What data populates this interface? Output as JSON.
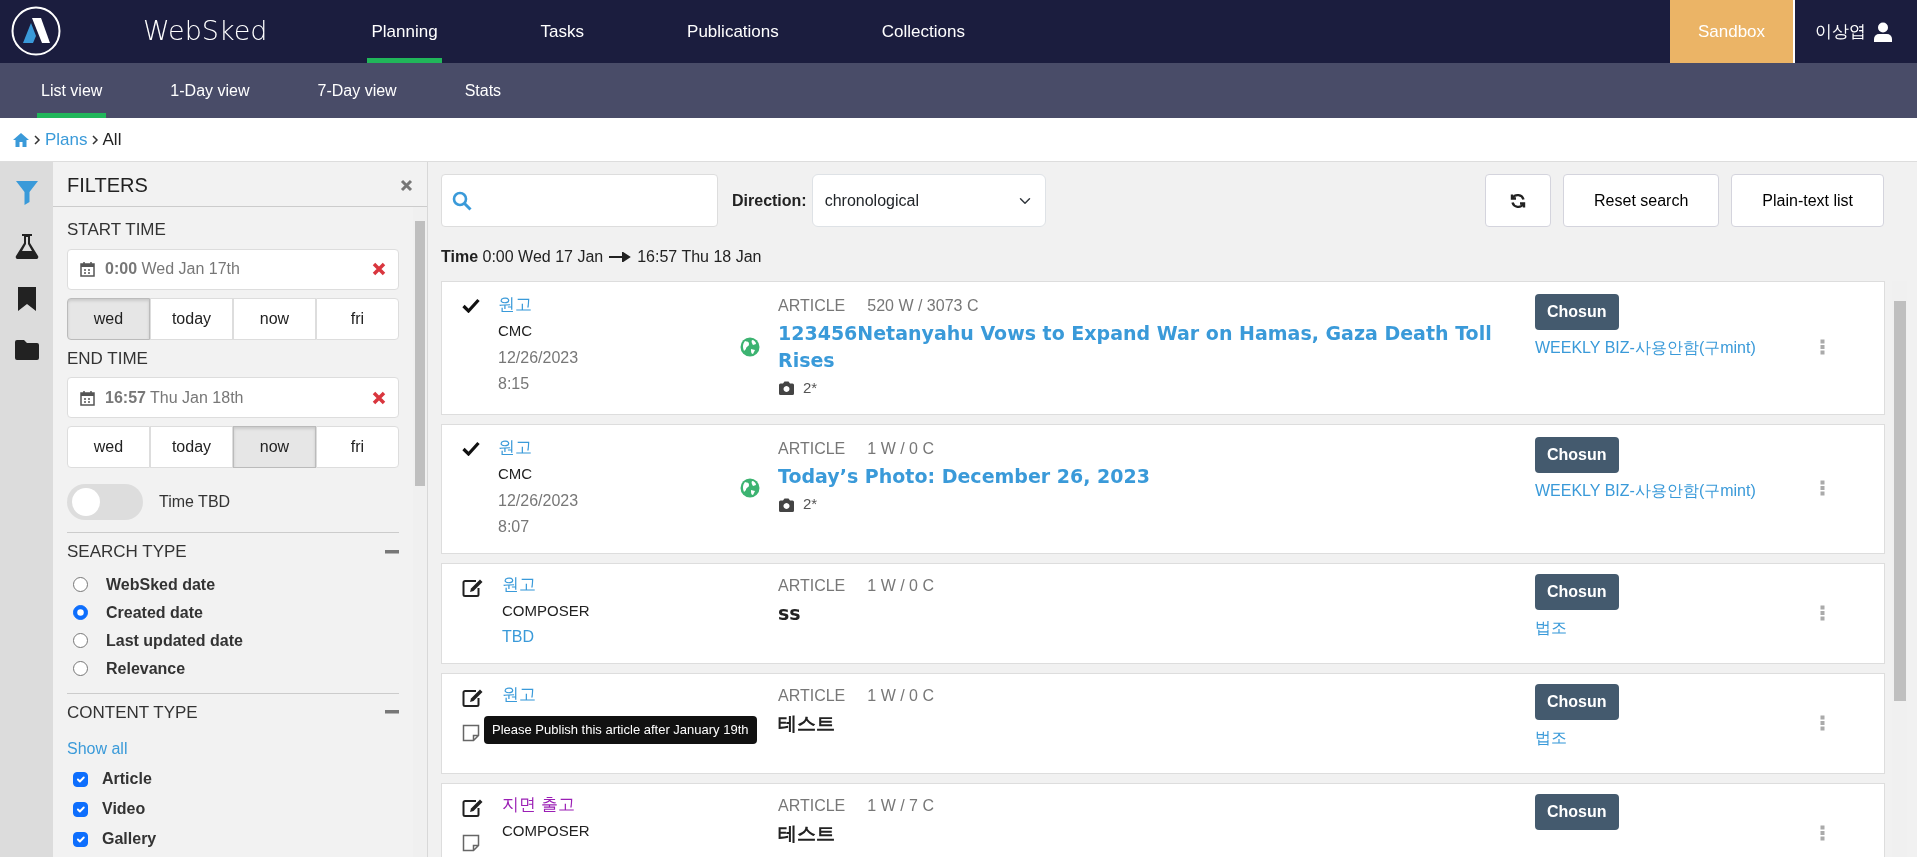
{
  "app": {
    "name": "WebSked"
  },
  "nav_tabs": [
    {
      "label": "Planning",
      "selected": true
    },
    {
      "label": "Tasks",
      "selected": false
    },
    {
      "label": "Publications",
      "selected": false
    },
    {
      "label": "Collections",
      "selected": false
    }
  ],
  "environment": "Sandbox",
  "user": "이상엽",
  "sub_tabs": [
    {
      "label": "List view",
      "selected": true
    },
    {
      "label": "1-Day view",
      "selected": false
    },
    {
      "label": "7-Day view",
      "selected": false
    },
    {
      "label": "Stats",
      "selected": false
    }
  ],
  "breadcrumb": {
    "link": "Plans",
    "current": "All"
  },
  "sidebar_icons": [
    {
      "kind": "filter",
      "selected": true
    },
    {
      "kind": "flask",
      "selected": false
    },
    {
      "kind": "bookmark",
      "selected": false
    },
    {
      "kind": "folder",
      "selected": false
    }
  ],
  "filters": {
    "title": "FILTERS",
    "start": {
      "label": "START TIME",
      "time": "0:00",
      "date": "Wed Jan 17th",
      "quick": [
        {
          "label": "wed",
          "selected": true
        },
        {
          "label": "today",
          "selected": false
        },
        {
          "label": "now",
          "selected": false
        },
        {
          "label": "fri",
          "selected": false
        }
      ]
    },
    "end": {
      "label": "END TIME",
      "time": "16:57",
      "date": "Thu Jan 18th",
      "quick": [
        {
          "label": "wed",
          "selected": false
        },
        {
          "label": "today",
          "selected": false
        },
        {
          "label": "now",
          "selected": true
        },
        {
          "label": "fri",
          "selected": false
        }
      ]
    },
    "time_tbd": {
      "label": "Time TBD",
      "on": false
    },
    "search_type": {
      "title": "SEARCH TYPE",
      "options": [
        {
          "label": "WebSked date",
          "selected": false
        },
        {
          "label": "Created date",
          "selected": true
        },
        {
          "label": "Last updated date",
          "selected": false
        },
        {
          "label": "Relevance",
          "selected": false
        }
      ]
    },
    "content_type": {
      "title": "CONTENT TYPE",
      "show_all": "Show all",
      "options": [
        {
          "label": "Article",
          "checked": true
        },
        {
          "label": "Video",
          "checked": true
        },
        {
          "label": "Gallery",
          "checked": true
        }
      ]
    }
  },
  "toolbar": {
    "direction_label": "Direction:",
    "direction": "chronological",
    "buttons": [
      "Reset search",
      "Plain-text list"
    ]
  },
  "time_range": {
    "label": "Time",
    "from": "0:00 Wed 17 Jan",
    "to": "16:57 Thu 18 Jan"
  },
  "items": [
    {
      "kind": "published",
      "has_note": false,
      "type_label": "원고",
      "color": "#3a9ad9",
      "source": "CMC",
      "date": "12/26/2023",
      "time": "8:15",
      "kind_label": "ARTICLE",
      "counts": "520 W / 3073 C",
      "title": "123456Netanyahu Vows to Expand War on Hamas, Gaza Death Toll Rises",
      "photos": "2*",
      "publication": "Chosun",
      "section": "WEEKLY BIZ-사용안함(구mint)"
    },
    {
      "kind": "published",
      "has_note": false,
      "type_label": "원고",
      "color": "#3a9ad9",
      "source": "CMC",
      "date": "12/26/2023",
      "time": "8:07",
      "kind_label": "ARTICLE",
      "counts": "1 W / 0 C",
      "title": "Today’s Photo: December 26, 2023",
      "photos": "2*",
      "publication": "Chosun",
      "section": "WEEKLY BIZ-사용안함(구mint)"
    },
    {
      "kind": "draft",
      "has_note": false,
      "type_label": "원고",
      "color": "#3a9ad9",
      "source": "COMPOSER",
      "schedule": "TBD",
      "kind_label": "ARTICLE",
      "counts": "1 W / 0 C",
      "title": "ss",
      "publication": "Chosun",
      "section": "법조"
    },
    {
      "kind": "draft",
      "has_note": true,
      "type_label": "원고",
      "color": "#3a9ad9",
      "kind_label": "ARTICLE",
      "counts": "1 W / 0 C",
      "title": "테스트",
      "publication": "Chosun",
      "section": "법조",
      "tooltip": "Please Publish this article after January 19th"
    },
    {
      "kind": "draft",
      "has_note": true,
      "type_label": "지면 출고",
      "color": "#9b1fb5",
      "source": "COMPOSER",
      "kind_label": "ARTICLE",
      "counts": "1 W / 7 C",
      "title": "테스트",
      "publication": "Chosun"
    }
  ]
}
